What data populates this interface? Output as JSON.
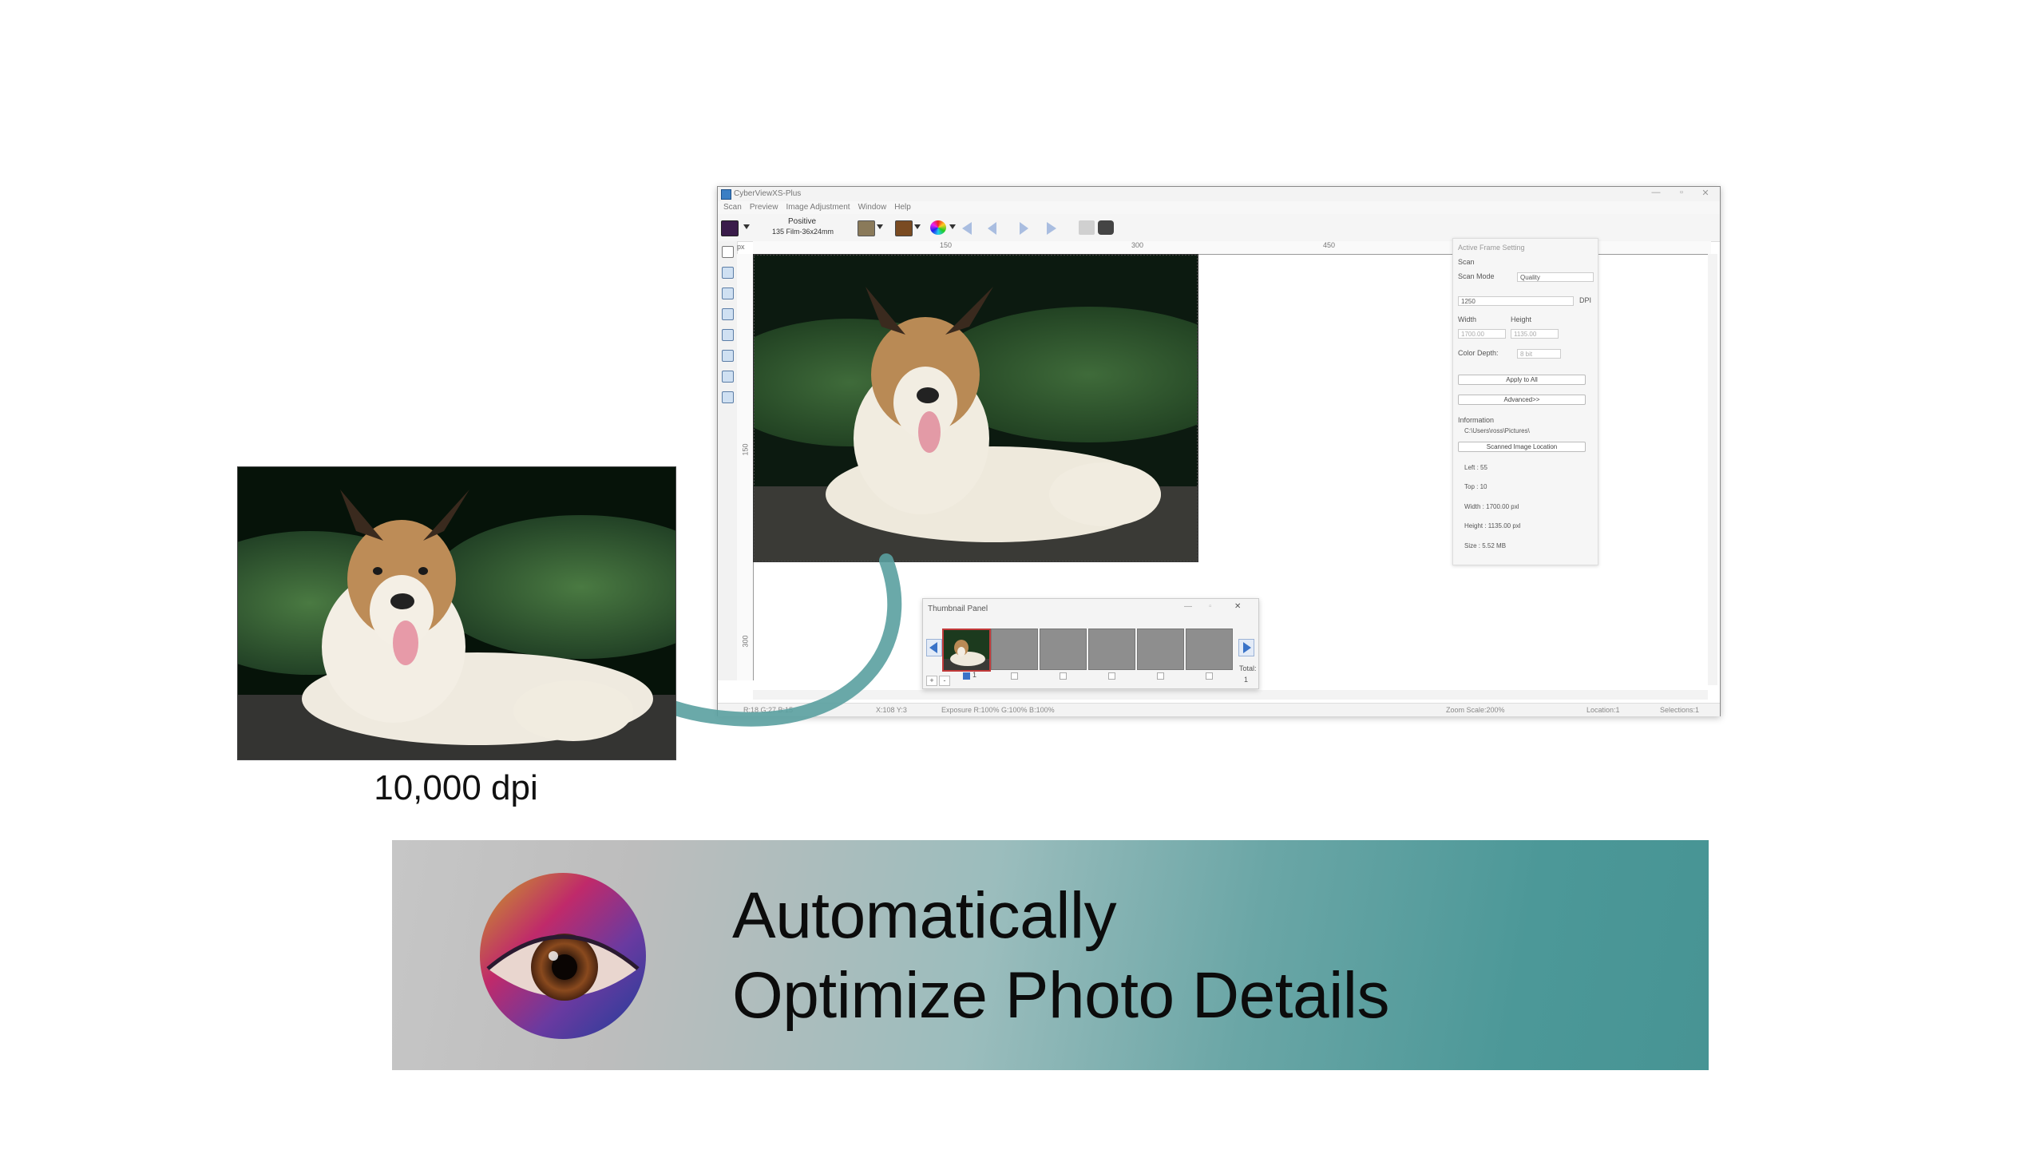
{
  "app": {
    "title": "CyberViewXS-Plus",
    "menu": [
      "Scan",
      "Preview",
      "Image Adjustment",
      "Window",
      "Help"
    ],
    "toolbar": {
      "mode_label": "Positive",
      "film_label": "135 Film-36x24mm"
    },
    "ruler": {
      "unit": "px",
      "h_ticks": [
        "150",
        "300",
        "450"
      ],
      "v_ticks": [
        "150",
        "300"
      ]
    },
    "statusbar": {
      "rgb": "R:18 G:27 B:15",
      "xy": "X:108 Y:3",
      "exposure": "Exposure R:100% G:100% B:100%",
      "zoom": "Zoom Scale:200%",
      "location": "Location:1",
      "selections": "Selections:1"
    }
  },
  "active_frame_setting": {
    "title": "Active Frame Setting",
    "section_scan": "Scan",
    "scan_mode_label": "Scan Mode",
    "scan_mode_value": "Quality",
    "dpi_value": "1250",
    "dpi_unit": "DPI",
    "width_label": "Width",
    "height_label": "Height",
    "width_value": "1700.00",
    "height_value": "1135.00",
    "color_depth_label": "Color Depth:",
    "color_depth_value": "8 bit",
    "apply_all_button": "Apply to All",
    "advanced_button": "Advanced>>",
    "information_label": "Information",
    "path": "C:\\Users\\ross\\Pictures\\",
    "location_button": "Scanned Image Location",
    "left": "Left : 55",
    "top": "Top : 10",
    "width_info": "Width : 1700.00 pxl",
    "height_info": "Height : 1135.00 pxl",
    "size_info": "Size : 5.52 MB"
  },
  "thumbnail_panel": {
    "title": "Thumbnail Panel",
    "first_label": "1",
    "total_label": "Total:",
    "total_value": "1"
  },
  "caption": "10,000 dpi",
  "banner": {
    "line1": "Automatically",
    "line2": "Optimize Photo Details"
  },
  "colors": {
    "banner_left": "#c6c6c6",
    "banner_right": "#479494",
    "arrow": "#5aa0a0",
    "nav_arrow": "#3a73c8"
  }
}
